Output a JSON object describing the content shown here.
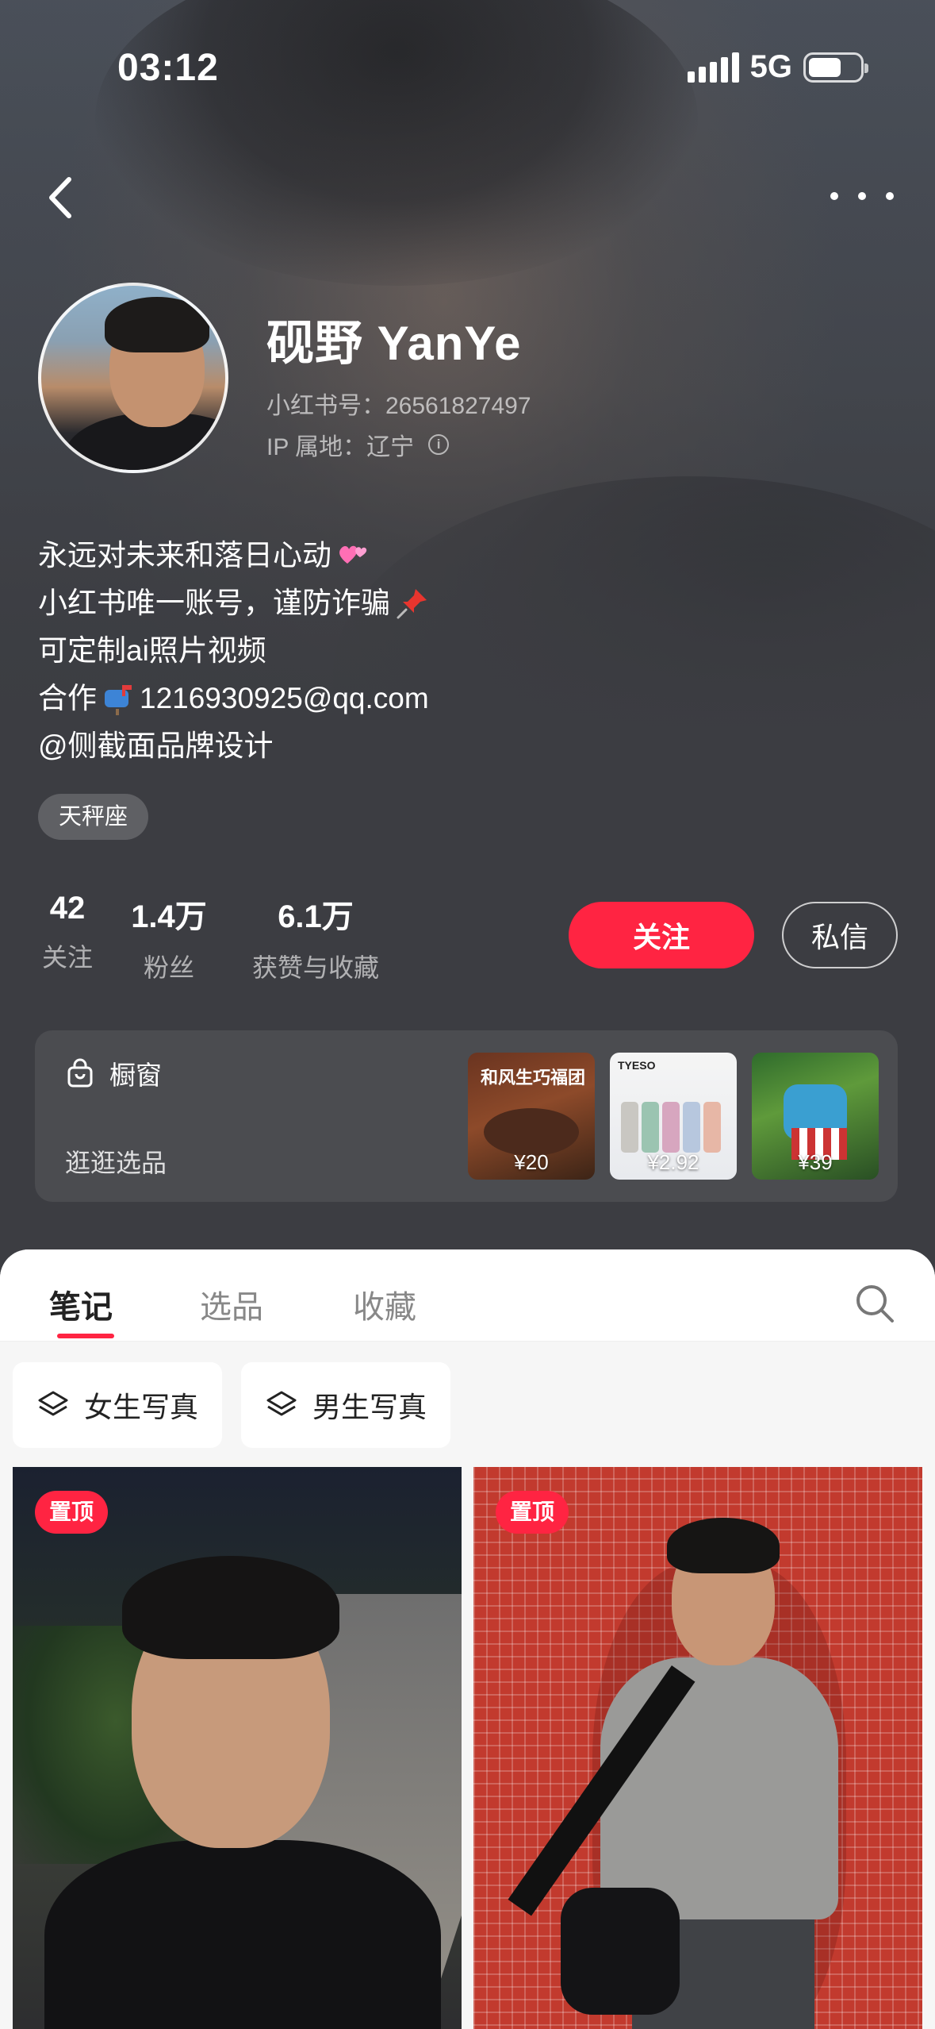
{
  "status_bar": {
    "time": "03:12",
    "network": "5G"
  },
  "profile": {
    "name": "砚野 YanYe",
    "id_text": "小红书号：26561827497",
    "ip_label": "IP 属地：辽宁",
    "bio": {
      "line1": "永远对未来和落日心动",
      "line2": "小红书唯一账号，谨防诈骗",
      "line3": "可定制ai照片视频",
      "line4_prefix": "合作",
      "line4_email": "1216930925@qq.com",
      "line5": "@侧截面品牌设计"
    },
    "tag": "天秤座"
  },
  "stats": [
    {
      "value": "42",
      "label": "关注"
    },
    {
      "value": "1.4万",
      "label": "粉丝"
    },
    {
      "value": "6.1万",
      "label": "获赞与收藏"
    }
  ],
  "actions": {
    "follow": "关注",
    "message": "私信"
  },
  "shop": {
    "title": "橱窗",
    "subtitle": "逛逛选品",
    "products": [
      {
        "price": "¥20",
        "caption": "和风生巧福团"
      },
      {
        "price": "¥2.92",
        "brand": "TYESO"
      },
      {
        "price": "¥39"
      }
    ]
  },
  "tabs": [
    "笔记",
    "选品",
    "收藏"
  ],
  "collections": [
    "女生写真",
    "男生写真"
  ],
  "notes": [
    {
      "badge": "置顶"
    },
    {
      "badge": "置顶"
    }
  ],
  "icons": {
    "back": "chevron-left-icon",
    "more": "more-dots-icon",
    "search": "search-icon",
    "shop": "bag-icon",
    "collection": "layers-icon",
    "info": "info-icon"
  },
  "colors": {
    "accent": "#ff2442",
    "header_bg": "#3c3d42"
  }
}
